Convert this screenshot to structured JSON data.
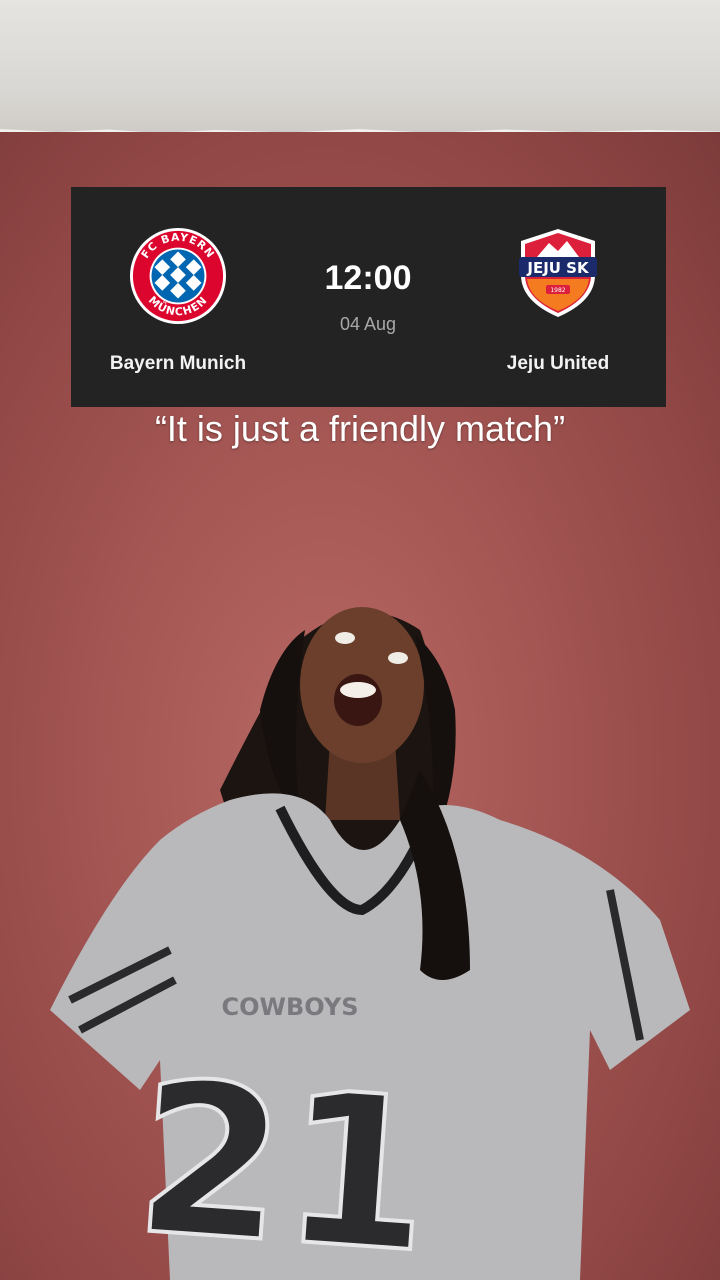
{
  "match": {
    "home_team": "Bayern Munich",
    "away_team": "Jeju United",
    "kickoff_time": "12:00",
    "date": "04 Aug",
    "home_logo_text": "FC BAYERN MÜNCHEN",
    "away_logo_text": "JEJU SK",
    "away_logo_year": "1982"
  },
  "caption": "“It is just a friendly match”",
  "jersey": {
    "number": "21",
    "team_text": "COWBOYS"
  },
  "colors": {
    "card_bg": "#232323",
    "wall": "#a65855",
    "bayern_red": "#dc052d",
    "bayern_blue": "#0066b2",
    "jeju_orange": "#f47b20",
    "jeju_navy": "#1b2a6b"
  }
}
